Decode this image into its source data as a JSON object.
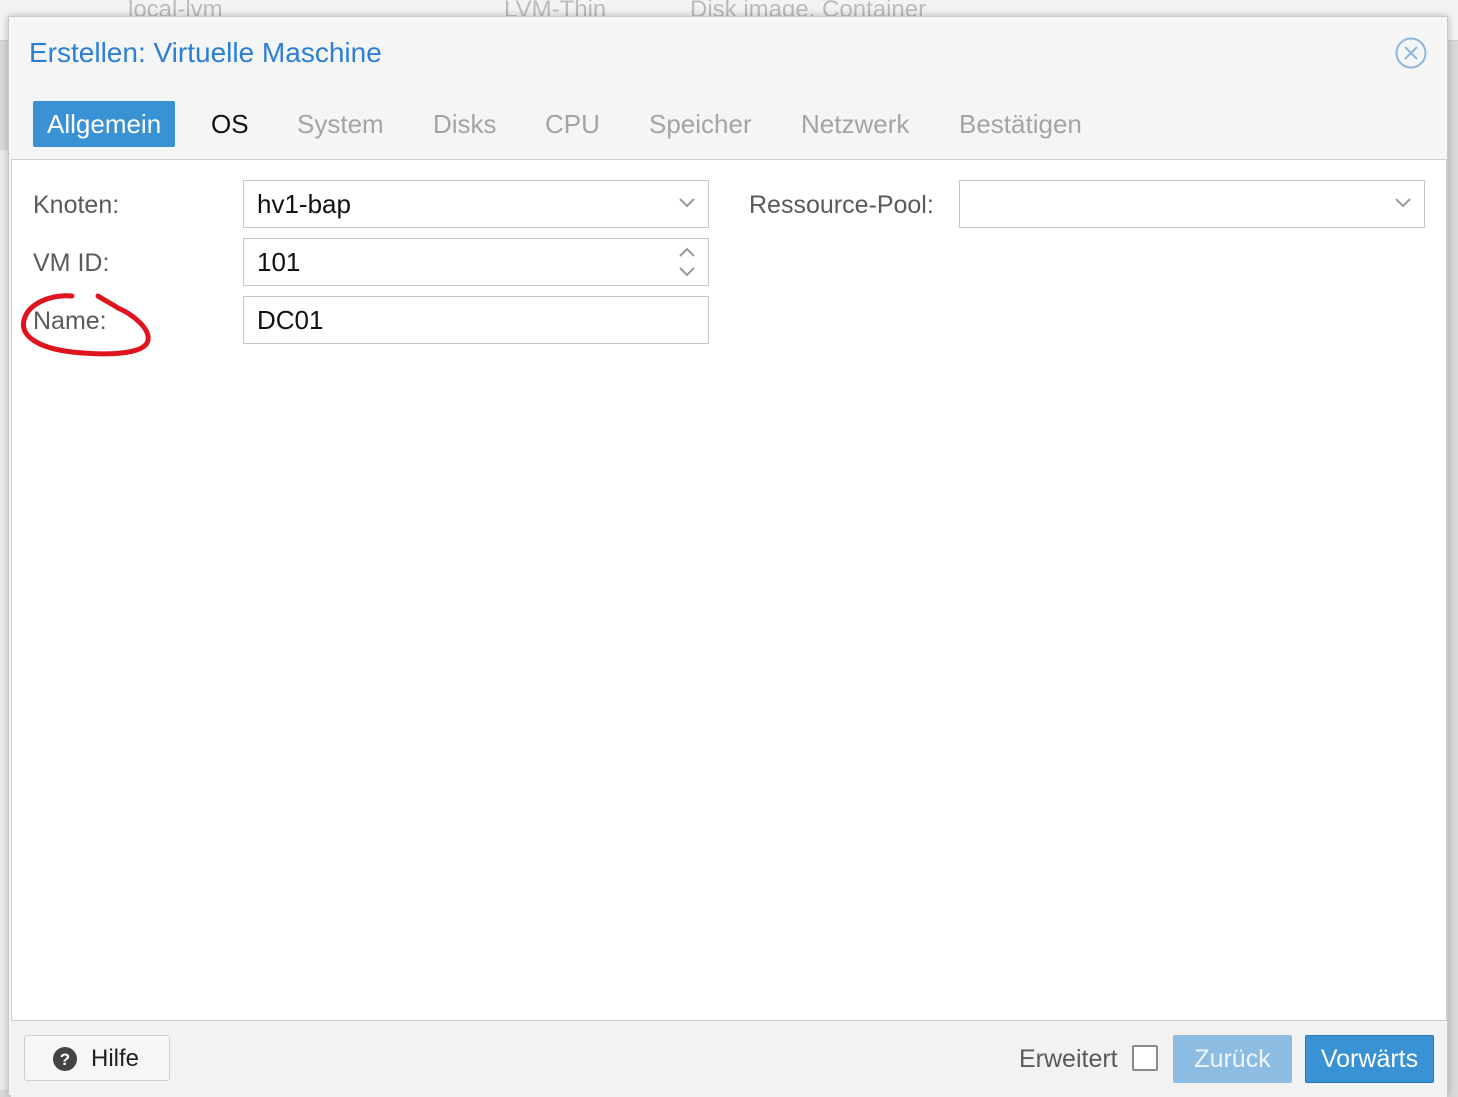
{
  "background": {
    "list_row": [
      "local-lvm",
      "LVM-Thin",
      "Disk image, Container"
    ]
  },
  "dialog": {
    "title": "Erstellen: Virtuelle Maschine",
    "close_icon": "close-circle-icon"
  },
  "tabs": [
    {
      "label": "Allgemein",
      "state": "active"
    },
    {
      "label": "OS",
      "state": "enabled"
    },
    {
      "label": "System",
      "state": "disabled"
    },
    {
      "label": "Disks",
      "state": "disabled"
    },
    {
      "label": "CPU",
      "state": "disabled"
    },
    {
      "label": "Speicher",
      "state": "disabled"
    },
    {
      "label": "Netzwerk",
      "state": "disabled"
    },
    {
      "label": "Bestätigen",
      "state": "disabled"
    }
  ],
  "form": {
    "node": {
      "label": "Knoten:",
      "value": "hv1-bap"
    },
    "vmid": {
      "label": "VM ID:",
      "value": "101"
    },
    "name": {
      "label": "Name:",
      "value": "DC01"
    },
    "pool": {
      "label": "Ressource-Pool:",
      "value": ""
    }
  },
  "footer": {
    "help_label": "Hilfe",
    "advanced_label": "Erweitert",
    "advanced_checked": false,
    "back_label": "Zurück",
    "next_label": "Vorwärts"
  },
  "colors": {
    "accent": "#3892d3",
    "title": "#2b7fd4",
    "annotation": "#e0141e"
  }
}
